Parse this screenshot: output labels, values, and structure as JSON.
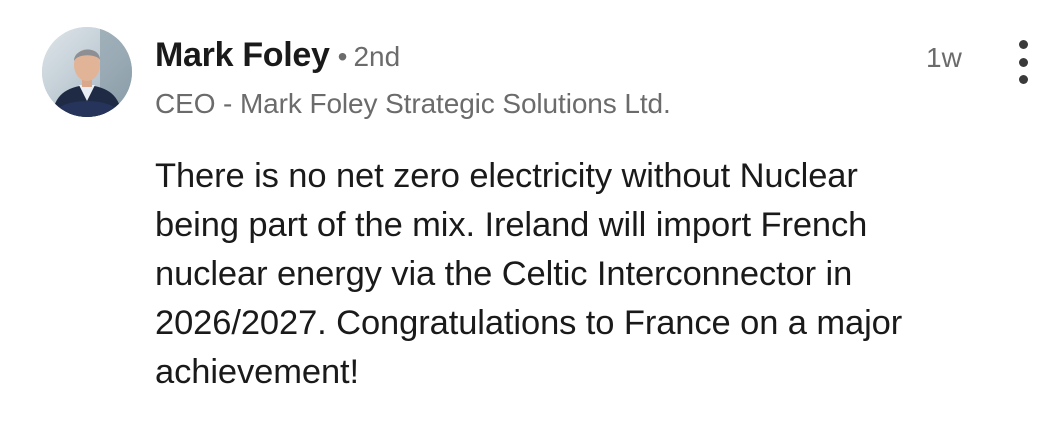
{
  "post": {
    "author": {
      "name": "Mark Foley",
      "separator": "•",
      "connection_degree": "2nd",
      "headline": "CEO - Mark Foley Strategic Solutions Ltd."
    },
    "timestamp": "1w",
    "more_icon": "more-vertical-icon",
    "body_lines": [
      "There is no net zero electricity without Nuclear",
      "being part of the mix. Ireland will import French",
      "nuclear energy via the Celtic Interconnector in",
      "2026/2027. Congratulations to France on a major",
      "achievement!"
    ]
  },
  "colors": {
    "text_primary": "#1a1a1a",
    "text_secondary": "#6b6b6b",
    "background": "#ffffff"
  }
}
